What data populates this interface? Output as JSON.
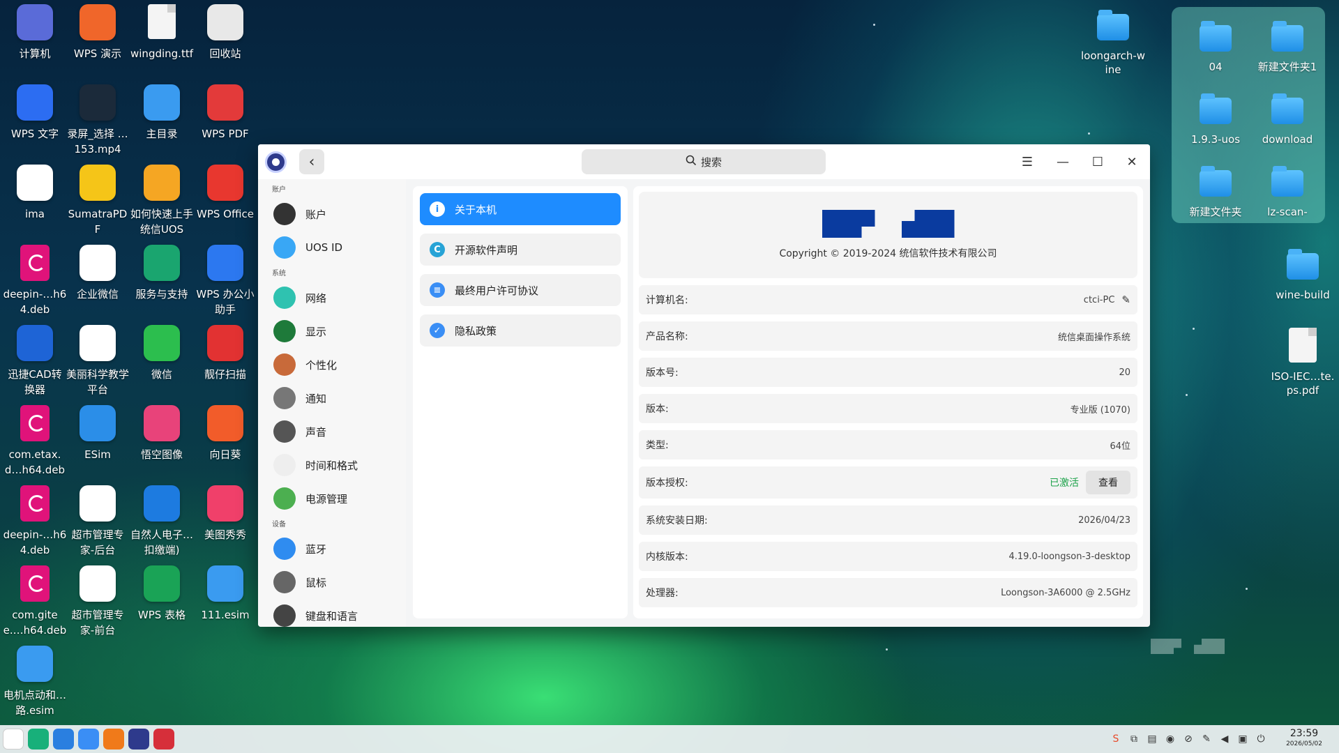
{
  "desktop_icons": [
    {
      "label": "计算机",
      "icon": "computer-icon",
      "color": "#5a6bd8"
    },
    {
      "label": "WPS 演示",
      "icon": "wps-presentation-icon",
      "color": "#f0662a"
    },
    {
      "label": "wingding.ttf",
      "icon": "font-file-icon",
      "color": "#d9d9d9"
    },
    {
      "label": "回收站",
      "icon": "trash-icon",
      "color": "#e8e8e8"
    },
    {
      "label": "WPS 文字",
      "icon": "wps-writer-icon",
      "color": "#2c6df2"
    },
    {
      "label": "录屏_选择 …153.mp4",
      "icon": "video-file-icon",
      "color": "#1b2a3a"
    },
    {
      "label": "主目录",
      "icon": "home-folder-icon",
      "color": "#3a9bf0"
    },
    {
      "label": "WPS PDF",
      "icon": "wps-pdf-icon",
      "color": "#e33a3a"
    },
    {
      "label": "ima",
      "icon": "panda-icon",
      "color": "#ffffff"
    },
    {
      "label": "SumatraPDF",
      "icon": "sumatra-pdf-icon",
      "color": "#f5c518"
    },
    {
      "label": "如何快速上手统信UOS",
      "icon": "uos-guide-icon",
      "color": "#f5a623"
    },
    {
      "label": "WPS Office",
      "icon": "wps-office-icon",
      "color": "#e8372f"
    },
    {
      "label": "deepin-…h64.deb",
      "icon": "deb-package-icon",
      "color": "#e0137a"
    },
    {
      "label": "企业微信",
      "icon": "wecom-icon",
      "color": "#ffffff"
    },
    {
      "label": "服务与支持",
      "icon": "support-icon",
      "color": "#1aa56f"
    },
    {
      "label": "WPS 办公小助手",
      "icon": "wps-assistant-icon",
      "color": "#2c78f0"
    },
    {
      "label": "迅捷CAD转换器",
      "icon": "cad-converter-icon",
      "color": "#1e64d6"
    },
    {
      "label": "美丽科学教学平台",
      "icon": "science-platform-icon",
      "color": "#ffffff"
    },
    {
      "label": "微信",
      "icon": "wechat-icon",
      "color": "#2cbe4e"
    },
    {
      "label": "靓仔扫描",
      "icon": "scanner-icon",
      "color": "#e23232"
    },
    {
      "label": "com.etax.d…h64.deb",
      "icon": "deb-package-icon",
      "color": "#e0137a"
    },
    {
      "label": "ESim",
      "icon": "esim-tools-icon",
      "color": "#2b8ee8"
    },
    {
      "label": "悟空图像",
      "icon": "wukong-image-icon",
      "color": "#e8437a"
    },
    {
      "label": "向日葵",
      "icon": "sunlogin-icon",
      "color": "#f25c2a"
    },
    {
      "label": "deepin-…h64.deb",
      "icon": "deb-package-icon",
      "color": "#e0137a"
    },
    {
      "label": "超市管理专家-后台",
      "icon": "supermarket-admin-icon",
      "color": "#ffffff"
    },
    {
      "label": "自然人电子…扣缴端)",
      "icon": "tax-client-icon",
      "color": "#1d7be0"
    },
    {
      "label": "美图秀秀",
      "icon": "meitu-icon",
      "color": "#f0406a"
    },
    {
      "label": "com.gitee.…h64.deb",
      "icon": "deb-package-icon",
      "color": "#e0137a"
    },
    {
      "label": "超市管理专家-前台",
      "icon": "supermarket-pos-icon",
      "color": "#ffffff"
    },
    {
      "label": "WPS 表格",
      "icon": "wps-spreadsheet-icon",
      "color": "#1aa356"
    },
    {
      "label": "111.esim",
      "icon": "esim-file-icon",
      "color": "#3a9bf0"
    },
    {
      "label": "电机点动和…路.esim",
      "icon": "esim-file-icon",
      "color": "#3a9bf0"
    }
  ],
  "desktop_right": {
    "top_folder": "loongarch-wine",
    "widget_folders": [
      "04",
      "新建文件夹1",
      "1.9.3-uos",
      "download",
      "新建文件夹",
      "lz-scan-"
    ],
    "wine_build": "wine-build",
    "pdf_file": "ISO-IEC…te.ps.pdf"
  },
  "window": {
    "search_placeholder": "搜索",
    "sidebar": {
      "groups": [
        {
          "title": "账户",
          "items": [
            {
              "label": "账户",
              "icon": "account-icon",
              "color": "#333333"
            },
            {
              "label": "UOS ID",
              "icon": "cloud-icon",
              "color": "#39a7f5"
            }
          ]
        },
        {
          "title": "系统",
          "items": [
            {
              "label": "网络",
              "icon": "network-icon",
              "color": "#2fc2b0"
            },
            {
              "label": "显示",
              "icon": "display-icon",
              "color": "#1e7a3a"
            },
            {
              "label": "个性化",
              "icon": "personalization-icon",
              "color": "#c86a3a"
            },
            {
              "label": "通知",
              "icon": "bell-icon",
              "color": "#777777"
            },
            {
              "label": "声音",
              "icon": "speaker-icon",
              "color": "#555555"
            },
            {
              "label": "时间和格式",
              "icon": "clock-icon",
              "color": "#eeeeee"
            },
            {
              "label": "电源管理",
              "icon": "battery-icon",
              "color": "#4caf50"
            }
          ]
        },
        {
          "title": "设备",
          "items": [
            {
              "label": "蓝牙",
              "icon": "bluetooth-icon",
              "color": "#2f8cf0"
            },
            {
              "label": "鼠标",
              "icon": "mouse-icon",
              "color": "#666666"
            },
            {
              "label": "键盘和语言",
              "icon": "keyboard-icon",
              "color": "#444444"
            }
          ]
        }
      ]
    },
    "about_menu": [
      {
        "label": "关于本机",
        "icon": "info-icon",
        "active": true
      },
      {
        "label": "开源软件声明",
        "icon": "open-source-icon",
        "active": false
      },
      {
        "label": "最终用户许可协议",
        "icon": "license-icon",
        "active": false
      },
      {
        "label": "隐私政策",
        "icon": "privacy-icon",
        "active": false
      }
    ],
    "copyright": "Copyright © 2019-2024 统信软件技术有限公司",
    "info_rows": [
      {
        "label": "计算机名:",
        "value": "ctci-PC",
        "editable": true
      },
      {
        "label": "产品名称:",
        "value": "统信桌面操作系统"
      },
      {
        "label": "版本号:",
        "value": "20"
      },
      {
        "label": "版本:",
        "value": "专业版 (1070)"
      },
      {
        "label": "类型:",
        "value": "64位"
      },
      {
        "label": "版本授权:",
        "value": "已激活",
        "button": "查看"
      },
      {
        "label": "系统安装日期:",
        "value": "2026/04/23"
      },
      {
        "label": "内核版本:",
        "value": "4.19.0-loongson-3-desktop"
      },
      {
        "label": "处理器:",
        "value": "Loongson-3A6000 @ 2.5GHz"
      }
    ]
  },
  "taskbar": {
    "apps": [
      {
        "name": "launcher-icon",
        "color": "#ffffff"
      },
      {
        "name": "desktop-icon",
        "color": "#18b07a"
      },
      {
        "name": "file-manager-icon",
        "color": "#2a7fe0"
      },
      {
        "name": "browser-icon",
        "color": "#3a8ef5"
      },
      {
        "name": "app-store-icon",
        "color": "#f07a1a"
      },
      {
        "name": "control-center-icon",
        "color": "#2e3a8c"
      },
      {
        "name": "terminal-icon",
        "color": "#d62f3a"
      }
    ],
    "time": "23:59",
    "date": "2026/05/02"
  }
}
